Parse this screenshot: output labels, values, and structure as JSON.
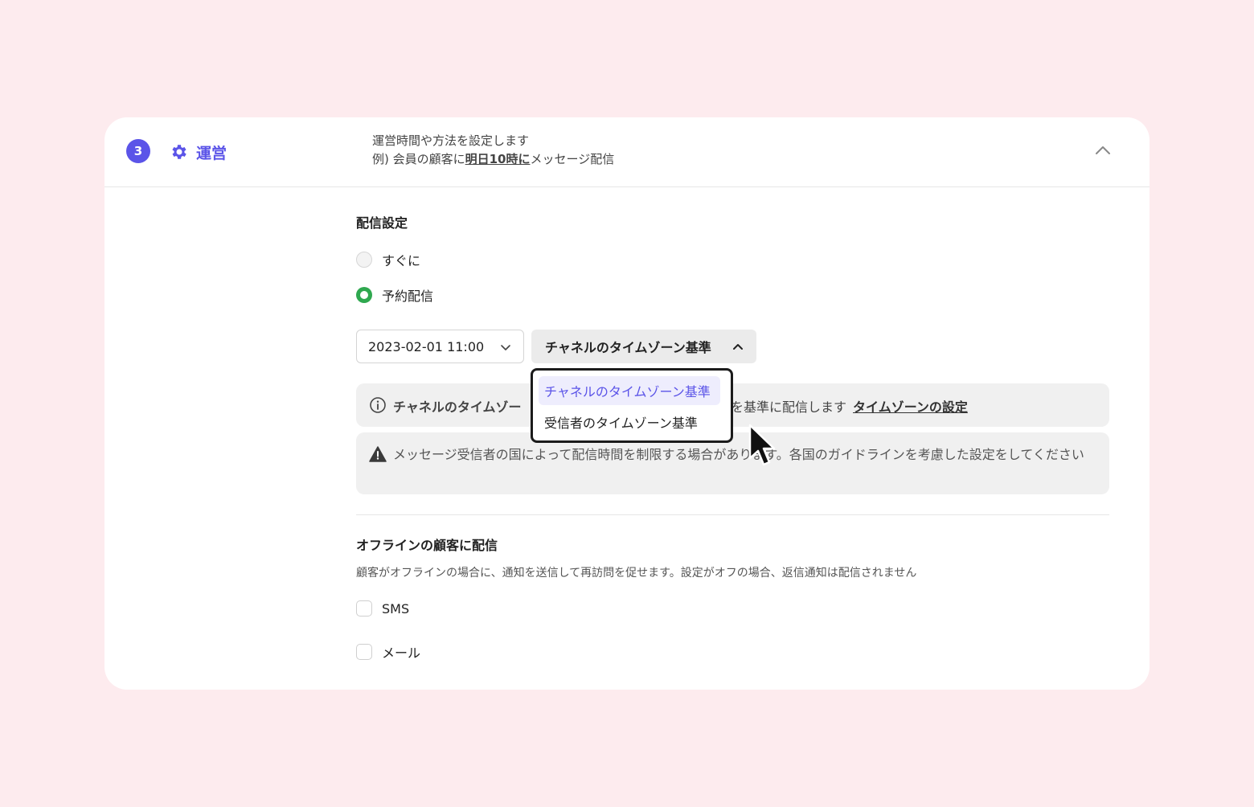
{
  "header": {
    "step_number": "3",
    "title": "運営",
    "description_line1": "運営時間や方法を設定します",
    "description_prefix": "例) 会員の顧客に",
    "description_emphasis": "明日10時に",
    "description_suffix": "メッセージ配信"
  },
  "delivery": {
    "label": "配信設定",
    "options": [
      {
        "label": "すぐに",
        "checked": false
      },
      {
        "label": "予約配信",
        "checked": true
      }
    ],
    "datetime_value": "2023-02-01 11:00",
    "timezone_selected": "チャネルのタイムゾーン基準",
    "timezone_options": [
      "チャネルのタイムゾーン基準",
      "受信者のタイムゾーン基準"
    ]
  },
  "info": {
    "left_text": "チャネルのタイムゾー",
    "right_text": "を基準に配信します",
    "link_text": "タイムゾーンの設定"
  },
  "warning": {
    "text": "メッセージ受信者の国によって配信時間を制限する場合があります。各国のガイドラインを考慮した設定をしてください"
  },
  "offline": {
    "title": "オフラインの顧客に配信",
    "description": "顧客がオフラインの場合に、通知を送信して再訪問を促せます。設定がオフの場合、返信通知は配信されません",
    "channels": [
      {
        "label": "SMS",
        "checked": false
      },
      {
        "label": "メール",
        "checked": false
      }
    ]
  },
  "colors": {
    "accent": "#5b54e8",
    "radio_checked": "#2fa84f",
    "background": "#fdebee"
  }
}
